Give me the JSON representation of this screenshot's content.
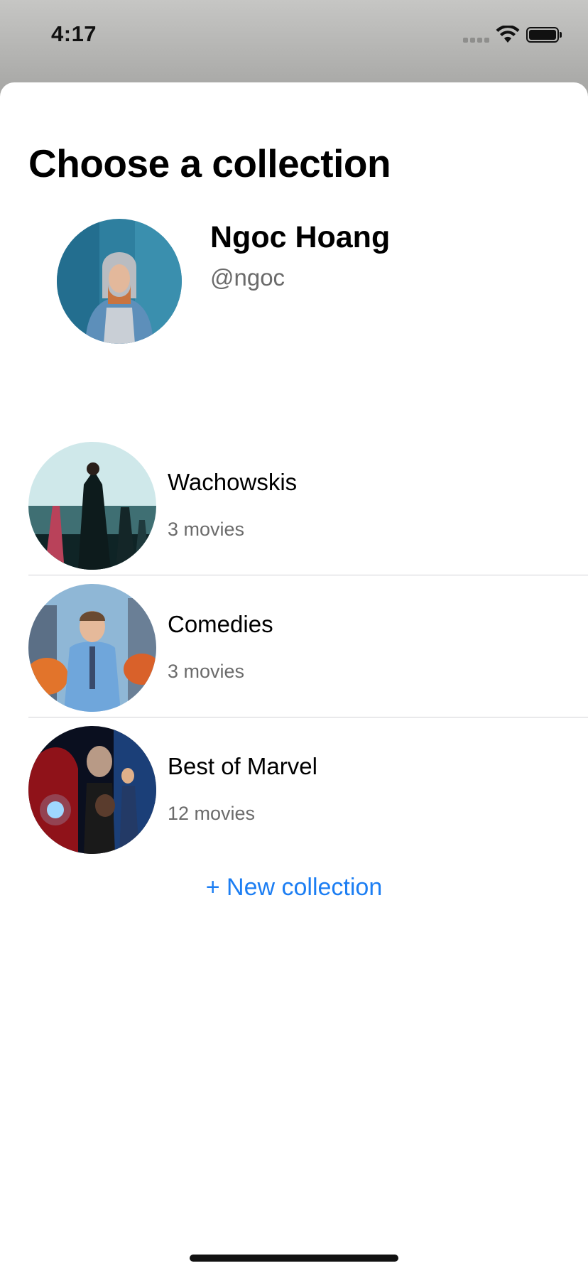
{
  "status_bar": {
    "time": "4:17",
    "icons": [
      "cellular-signal-icon",
      "wifi-icon",
      "battery-icon"
    ]
  },
  "sheet": {
    "title": "Choose a collection",
    "profile": {
      "name": "Ngoc Hoang",
      "handle": "@ngoc",
      "avatar_icon": "profile-photo"
    },
    "collections": [
      {
        "name": "Wachowskis",
        "count": "3 movies",
        "poster": "matrix-poster"
      },
      {
        "name": "Comedies",
        "count": "3 movies",
        "poster": "free-guy-poster"
      },
      {
        "name": "Best of Marvel",
        "count": "12 movies",
        "poster": "marvel-poster"
      }
    ],
    "new_collection_label": "+ New collection"
  },
  "colors": {
    "accent": "#1c7ef3",
    "secondary_text": "#6b6b6b",
    "divider": "#d1d1d6"
  }
}
